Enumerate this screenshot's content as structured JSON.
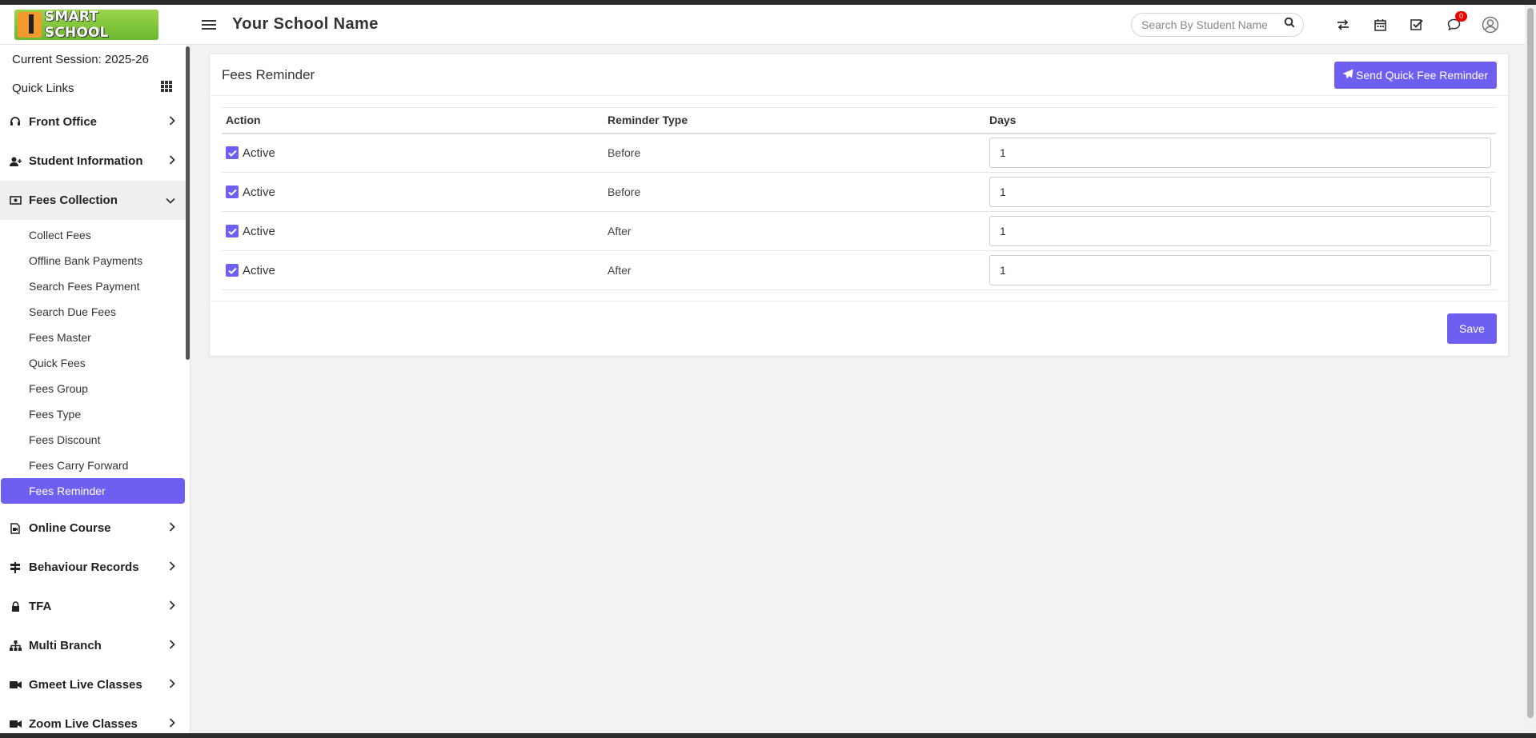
{
  "header": {
    "logo_text": "SMART SCHOOL",
    "school_name": "Your School Name",
    "search_placeholder": "Search By Student Name",
    "notification_count": "0"
  },
  "sidebar": {
    "session": "Current Session: 2025-26",
    "quick_links": "Quick Links",
    "menu_top": [
      {
        "label": "Front Office",
        "icon": "headset-icon"
      },
      {
        "label": "Student Information",
        "icon": "user-plus-icon"
      }
    ],
    "fees_collection": {
      "label": "Fees Collection",
      "items": [
        "Collect Fees",
        "Offline Bank Payments",
        "Search Fees Payment",
        "Search Due Fees",
        "Fees Master",
        "Quick Fees",
        "Fees Group",
        "Fees Type",
        "Fees Discount",
        "Fees Carry Forward",
        "Fees Reminder"
      ],
      "active_item": "Fees Reminder"
    },
    "menu_bottom": [
      {
        "label": "Online Course",
        "icon": "course-file-icon"
      },
      {
        "label": "Behaviour Records",
        "icon": "signpost-icon"
      },
      {
        "label": "TFA",
        "icon": "lock-icon"
      },
      {
        "label": "Multi Branch",
        "icon": "sitemap-icon"
      },
      {
        "label": "Gmeet Live Classes",
        "icon": "video-camera-icon"
      },
      {
        "label": "Zoom Live Classes",
        "icon": "video-camera-icon"
      }
    ]
  },
  "main": {
    "title": "Fees Reminder",
    "send_button": "Send Quick Fee Reminder",
    "columns": [
      "Action",
      "Reminder Type",
      "Days"
    ],
    "rows": [
      {
        "action": "Active",
        "checked": true,
        "type": "Before",
        "days": "1"
      },
      {
        "action": "Active",
        "checked": true,
        "type": "Before",
        "days": "1"
      },
      {
        "action": "Active",
        "checked": true,
        "type": "After",
        "days": "1"
      },
      {
        "action": "Active",
        "checked": true,
        "type": "After",
        "days": "1"
      }
    ],
    "save_button": "Save"
  },
  "colors": {
    "accent": "#6e5ff0",
    "badge": "#ee0000"
  }
}
